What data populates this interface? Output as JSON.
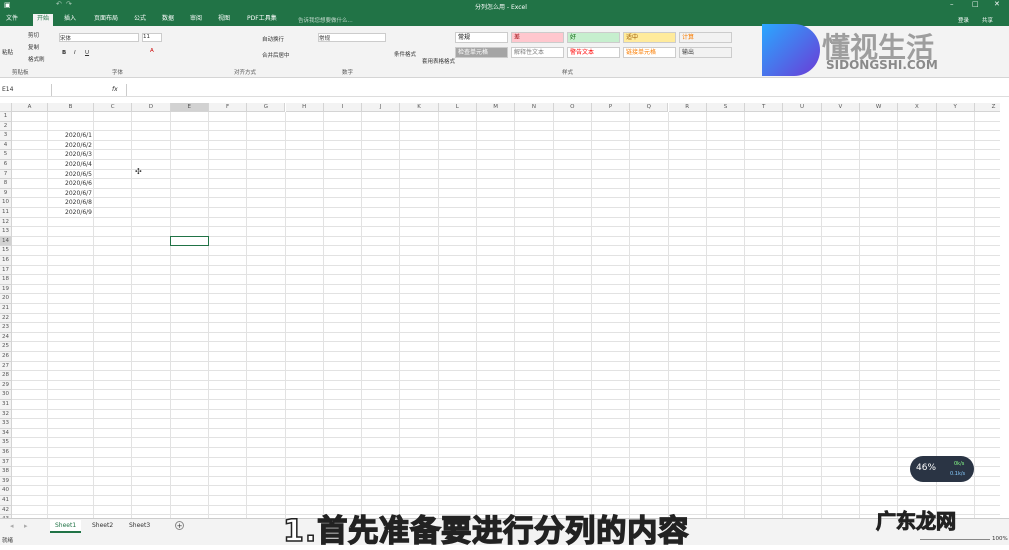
{
  "window": {
    "title": "分列怎么用 - Excel",
    "signin": "登录",
    "share": "共享"
  },
  "tabs": [
    "文件",
    "开始",
    "插入",
    "页面布局",
    "公式",
    "数据",
    "审阅",
    "视图",
    "PDF工具集"
  ],
  "tell_me": "告诉我您想要做什么...",
  "ribbon": {
    "clipboard": {
      "paste": "粘贴",
      "cut": "剪切",
      "copy": "复制",
      "format_painter": "格式刷",
      "label": "剪贴板"
    },
    "font": {
      "name": "宋体",
      "size": "11",
      "label": "字体",
      "bold": "B",
      "italic": "I",
      "underline": "U"
    },
    "alignment": {
      "wrap": "自动换行",
      "merge": "合并后居中",
      "label": "对齐方式"
    },
    "number": {
      "format": "常规",
      "label": "数字"
    },
    "styles": {
      "conditional": "条件格式",
      "table": "套用表格格式",
      "label": "样式",
      "cells": [
        {
          "text": "常规",
          "bg": "#ffffff",
          "color": "#000"
        },
        {
          "text": "差",
          "bg": "#ffc7ce",
          "color": "#9c0006"
        },
        {
          "text": "好",
          "bg": "#c6efce",
          "color": "#006100"
        },
        {
          "text": "适中",
          "bg": "#ffeb9c",
          "color": "#9c5700"
        },
        {
          "text": "计算",
          "bg": "#f2f2f2",
          "color": "#fa7d00"
        },
        {
          "text": "检查单元格",
          "bg": "#a5a5a5",
          "color": "#fff"
        },
        {
          "text": "解释性文本",
          "bg": "#ffffff",
          "color": "#7f7f7f"
        },
        {
          "text": "警告文本",
          "bg": "#ffffff",
          "color": "#ff0000"
        },
        {
          "text": "链接单元格",
          "bg": "#ffffff",
          "color": "#fa7d00"
        },
        {
          "text": "输出",
          "bg": "#f2f2f2",
          "color": "#3f3f3f"
        }
      ]
    }
  },
  "formula_bar": {
    "name_box": "E14",
    "fx": "fx",
    "value": ""
  },
  "columns": [
    "A",
    "B",
    "C",
    "D",
    "E",
    "F",
    "G",
    "H",
    "I",
    "J",
    "K",
    "L",
    "M",
    "N",
    "O",
    "P",
    "Q",
    "R",
    "S",
    "T",
    "U",
    "V",
    "W",
    "X",
    "Y",
    "Z"
  ],
  "cells": [
    {
      "row": 3,
      "col": "B",
      "value": "2020/6/1"
    },
    {
      "row": 4,
      "col": "B",
      "value": "2020/6/2"
    },
    {
      "row": 5,
      "col": "B",
      "value": "2020/6/3"
    },
    {
      "row": 6,
      "col": "B",
      "value": "2020/6/4"
    },
    {
      "row": 7,
      "col": "B",
      "value": "2020/6/5"
    },
    {
      "row": 8,
      "col": "B",
      "value": "2020/6/6"
    },
    {
      "row": 9,
      "col": "B",
      "value": "2020/6/7"
    },
    {
      "row": 10,
      "col": "B",
      "value": "2020/6/8"
    },
    {
      "row": 11,
      "col": "B",
      "value": "2020/6/9"
    }
  ],
  "selected": {
    "row": 14,
    "col": "E"
  },
  "sheets": [
    "Sheet1",
    "Sheet2",
    "Sheet3"
  ],
  "active_sheet": 0,
  "status": {
    "mode": "就绪",
    "zoom": "100%"
  },
  "overlay": {
    "subtitle": "1.首先准备要进行分列的内容",
    "watermark": "懂视生活",
    "watermark_url": "SIDONGSHI.COM",
    "corner_logo": "广东龙网",
    "speed": "46%",
    "up": "0k/s",
    "down": "0.1k/s"
  }
}
